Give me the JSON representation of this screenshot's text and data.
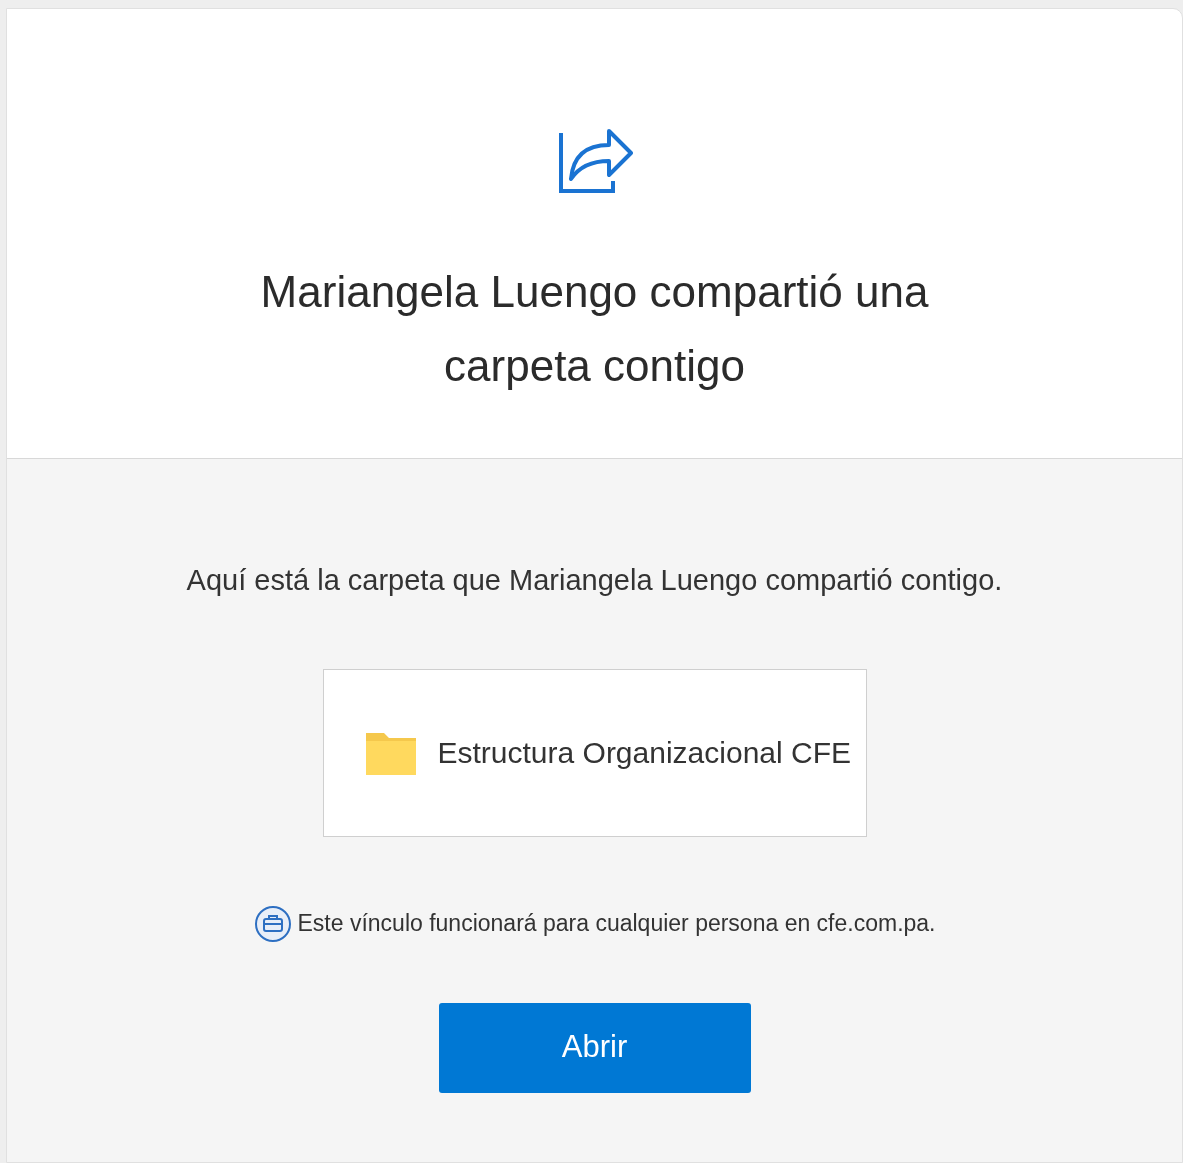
{
  "header": {
    "title": "Mariangela Luengo compartió una carpeta contigo"
  },
  "body": {
    "message": "Aquí está la carpeta que Mariangela Luengo compartió contigo.",
    "item": {
      "kind": "folder",
      "name": "Estructura Organizacional CFE"
    },
    "notice": "Este vínculo funcionará para cualquier persona en cfe.com.pa.",
    "button": "Abrir"
  }
}
